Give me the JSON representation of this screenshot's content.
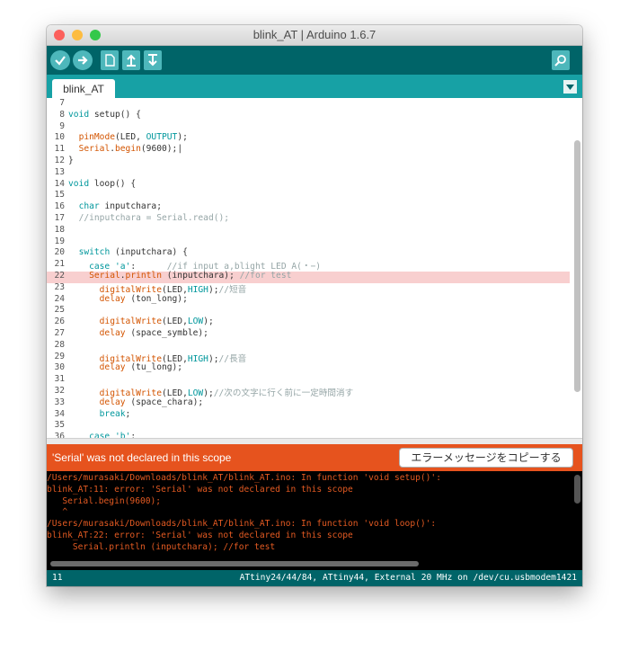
{
  "window": {
    "title": "blink_AT | Arduino 1.6.7"
  },
  "toolbar": {
    "buttons": [
      "verify",
      "upload",
      "new",
      "open",
      "save"
    ],
    "serial_monitor": "serial-monitor"
  },
  "tabs": [
    {
      "label": "blink_AT"
    }
  ],
  "editor": {
    "highlight_line": 22,
    "lines": [
      {
        "n": "7",
        "t": ""
      },
      {
        "n": "8",
        "t": "void setup() {"
      },
      {
        "n": "9",
        "t": ""
      },
      {
        "n": "10",
        "t": "  pinMode(LED, OUTPUT);"
      },
      {
        "n": "11",
        "t": "  Serial.begin(9600);|"
      },
      {
        "n": "12",
        "t": "}"
      },
      {
        "n": "13",
        "t": ""
      },
      {
        "n": "14",
        "t": "void loop() {"
      },
      {
        "n": "15",
        "t": ""
      },
      {
        "n": "16",
        "t": "  char inputchara;"
      },
      {
        "n": "17",
        "t": "  //inputchara = Serial.read();"
      },
      {
        "n": "18",
        "t": ""
      },
      {
        "n": "19",
        "t": ""
      },
      {
        "n": "20",
        "t": "  switch (inputchara) {"
      },
      {
        "n": "21",
        "t": "    case 'a':      //if input a,blight LED A(・−)"
      },
      {
        "n": "22",
        "t": "    Serial.println (inputchara); //for test"
      },
      {
        "n": "23",
        "t": "      digitalWrite(LED,HIGH);//短音"
      },
      {
        "n": "24",
        "t": "      delay (ton_long);"
      },
      {
        "n": "25",
        "t": ""
      },
      {
        "n": "26",
        "t": "      digitalWrite(LED,LOW);"
      },
      {
        "n": "27",
        "t": "      delay (space_symble);"
      },
      {
        "n": "28",
        "t": ""
      },
      {
        "n": "29",
        "t": "      digitalWrite(LED,HIGH);//長音"
      },
      {
        "n": "30",
        "t": "      delay (tu_long);"
      },
      {
        "n": "31",
        "t": ""
      },
      {
        "n": "32",
        "t": "      digitalWrite(LED,LOW);//次の文字に行く前に一定時間消す"
      },
      {
        "n": "33",
        "t": "      delay (space_chara);"
      },
      {
        "n": "34",
        "t": "      break;"
      },
      {
        "n": "35",
        "t": ""
      },
      {
        "n": "36",
        "t": "    case 'b':"
      }
    ]
  },
  "error_bar": {
    "message": "'Serial' was not declared in this scope",
    "copy_button": "エラーメッセージをコピーする"
  },
  "console": {
    "lines": [
      "/Users/murasaki/Downloads/blink_AT/blink_AT.ino: In function 'void setup()':",
      "blink_AT:11: error: 'Serial' was not declared in this scope",
      "   Serial.begin(9600);",
      "   ^",
      "/Users/murasaki/Downloads/blink_AT/blink_AT.ino: In function 'void loop()':",
      "blink_AT:22: error: 'Serial' was not declared in this scope",
      "     Serial.println (inputchara); //for test"
    ]
  },
  "status": {
    "line": "11",
    "board": "ATtiny24/44/84, ATtiny44, External 20 MHz on /dev/cu.usbmodem1421"
  },
  "colors": {
    "toolbar": "#006468",
    "tabbar": "#17a1a5",
    "error": "#e6531e",
    "highlight": "#f8cfcf"
  }
}
